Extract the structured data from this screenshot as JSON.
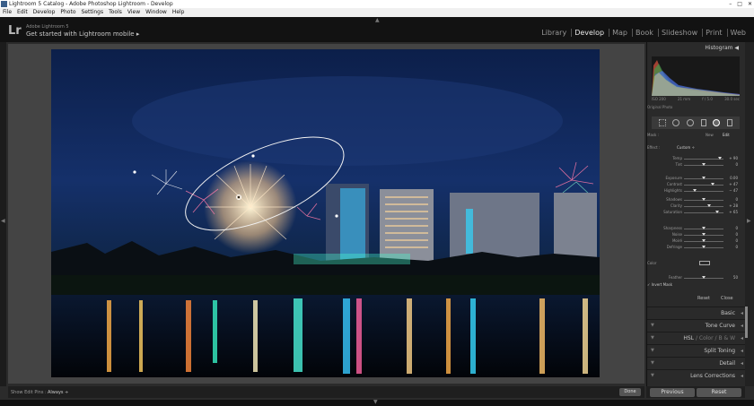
{
  "window": {
    "title": "Lightroom 5 Catalog - Adobe Photoshop Lightroom - Develop"
  },
  "menu": [
    "File",
    "Edit",
    "Develop",
    "Photo",
    "Settings",
    "Tools",
    "View",
    "Window",
    "Help"
  ],
  "identity": {
    "small": "Adobe Lightroom 5",
    "large": "Get started with Lightroom mobile ▸"
  },
  "modules": [
    "Library",
    "Develop",
    "Map",
    "Book",
    "Slideshow",
    "Print",
    "Web"
  ],
  "toolbar": {
    "label": "Show Edit Pins :",
    "value": "Always ÷",
    "done": "Done"
  },
  "histogram": {
    "title": "Histogram ◀",
    "readout": [
      "ISO 200",
      "21 mm",
      "f / 5.0",
      "30.0 sec"
    ],
    "original_photo": "Original Photo"
  },
  "mask": {
    "label": "Mask :",
    "new": "New",
    "edit": "Edit"
  },
  "effect": {
    "label": "Effect :",
    "value": "Custom ÷"
  },
  "sliders": [
    {
      "label": "Temp",
      "value": "+ 90",
      "pos": 0.9
    },
    {
      "label": "Tint",
      "value": "0",
      "pos": 0.5
    },
    {
      "label": "Exposure",
      "value": "0.00",
      "pos": 0.5
    },
    {
      "label": "Contrast",
      "value": "+ 47",
      "pos": 0.73
    },
    {
      "label": "Highlights",
      "value": "− 47",
      "pos": 0.27
    },
    {
      "label": "Shadows",
      "value": "0",
      "pos": 0.5
    },
    {
      "label": "Clarity",
      "value": "+ 28",
      "pos": 0.64
    },
    {
      "label": "Saturation",
      "value": "+ 65",
      "pos": 0.83
    },
    {
      "label": "Sharpness",
      "value": "0",
      "pos": 0.5
    },
    {
      "label": "Noise",
      "value": "0",
      "pos": 0.5
    },
    {
      "label": "Moiré",
      "value": "0",
      "pos": 0.5
    },
    {
      "label": "Defringe",
      "value": "0",
      "pos": 0.5
    }
  ],
  "color": {
    "label": "Color"
  },
  "feather": {
    "label": "Feather",
    "value": "50"
  },
  "invert_mask": "✓ Invert Mask",
  "tool_actions": {
    "reset": "Reset",
    "close": "Close"
  },
  "panels": {
    "basic": "Basic",
    "tone_curve": "Tone Curve",
    "hsl_a": "HSL",
    "hsl_b": "Color",
    "hsl_c": "B & W",
    "split_toning": "Split Toning",
    "detail": "Detail",
    "lens_corrections": "Lens Corrections"
  },
  "buttons": {
    "previous": "Previous",
    "reset": "Reset"
  },
  "colors": {
    "background": "#2b2b2b",
    "panel": "#2a2a2a",
    "active_module": "#e8e8e8"
  }
}
